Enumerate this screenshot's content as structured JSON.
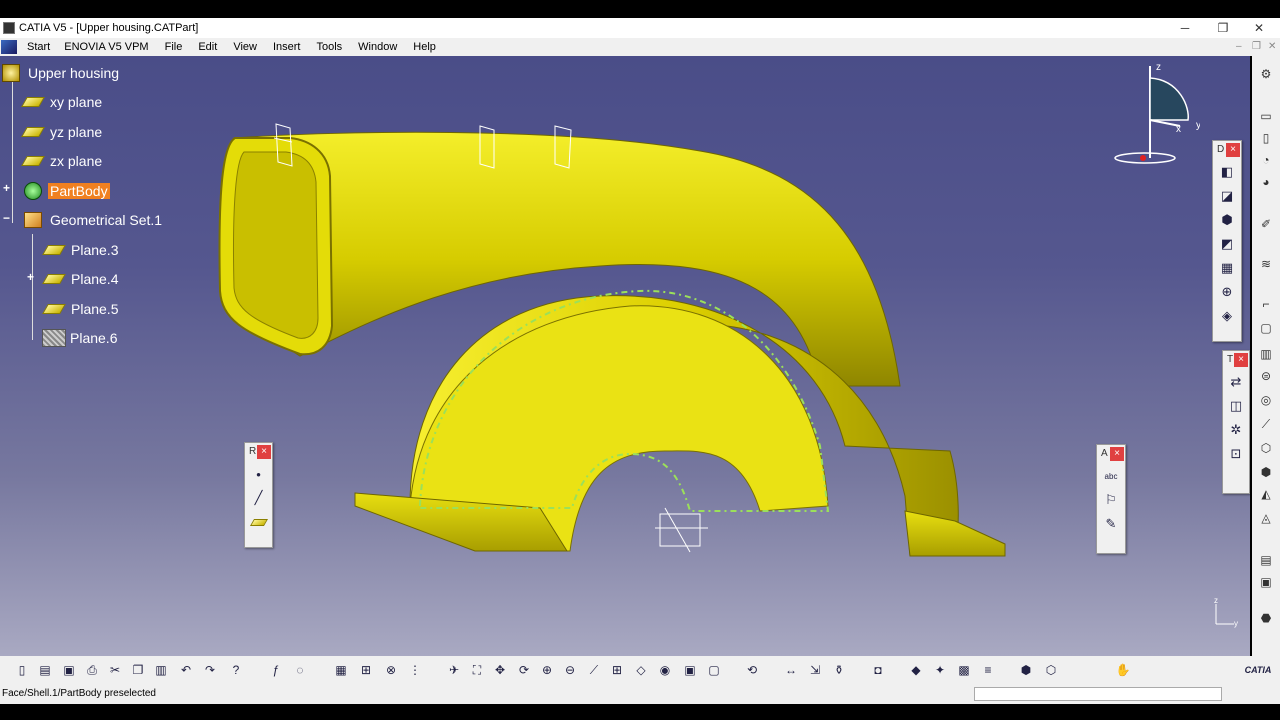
{
  "window": {
    "title": "CATIA V5 - [Upper housing.CATPart]",
    "controls": {
      "minimize": "─",
      "restore": "❐",
      "close": "✕"
    }
  },
  "menubar": {
    "items": [
      "Start",
      "ENOVIA V5 VPM",
      "File",
      "Edit",
      "View",
      "Insert",
      "Tools",
      "Window",
      "Help"
    ],
    "mdi_controls": {
      "minimize": "–",
      "restore": "❐",
      "close": "✕"
    }
  },
  "tree": {
    "root": "Upper housing",
    "items": [
      {
        "label": "xy plane",
        "icon": "plane-icon"
      },
      {
        "label": "yz plane",
        "icon": "plane-icon"
      },
      {
        "label": "zx plane",
        "icon": "plane-icon"
      },
      {
        "label": "PartBody",
        "icon": "part-body-icon",
        "selected": true
      },
      {
        "label": "Geometrical Set.1",
        "icon": "geometrical-set-icon"
      },
      {
        "label": "Plane.3",
        "icon": "plane-icon"
      },
      {
        "label": "Plane.4",
        "icon": "plane-icon"
      },
      {
        "label": "Plane.5",
        "icon": "plane-icon"
      },
      {
        "label": "Plane.6",
        "icon": "hidden-plane-icon"
      }
    ],
    "expanders": {
      "plus": "+",
      "minus": "−"
    }
  },
  "toolbars": {
    "reference": {
      "title": "R",
      "close": "×",
      "buttons": [
        "point-icon",
        "line-icon",
        "plane-icon"
      ]
    },
    "dress_up": {
      "title": "D",
      "close": "×"
    },
    "transform": {
      "title": "T",
      "close": "×"
    },
    "annotations": {
      "title": "A",
      "close": "×"
    }
  },
  "compass": {
    "axes": [
      "z",
      "x",
      "y"
    ]
  },
  "mini_axis": {
    "axes": [
      "z",
      "y"
    ]
  },
  "status": {
    "message": "Face/Shell.1/PartBody preselected"
  },
  "branding": {
    "catia": "CATIA"
  },
  "colors": {
    "viewport_top": "#4a4d88",
    "viewport_bottom": "#a9a9c2",
    "part_yellow": "#d8d000",
    "selection_orange": "#f08020"
  }
}
